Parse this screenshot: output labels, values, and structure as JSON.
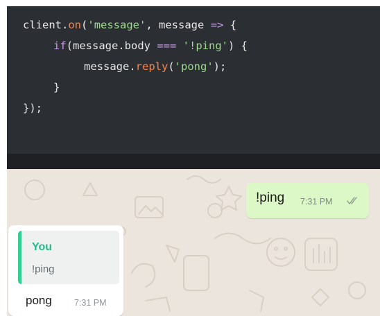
{
  "code": {
    "lines": [
      {
        "t1": "client",
        "t2": ".",
        "t3": "on",
        "t4": "(",
        "t5": "'message'",
        "t6": ", message ",
        "t7": "=>",
        "t8": " {"
      },
      {
        "t1": "if",
        "t2": "(message.body ",
        "t3": "===",
        "t4": " ",
        "t5": "'!ping'",
        "t6": ") {"
      },
      {
        "t1": "message.",
        "t2": "reply",
        "t3": "(",
        "t4": "'pong'",
        "t5": ");"
      },
      {
        "t1": "}"
      },
      {
        "t1": "});"
      }
    ]
  },
  "chat": {
    "outgoing": {
      "text": "!ping",
      "time": "7:31 PM",
      "status_icon": "double-check-icon"
    },
    "incoming": {
      "quote_author": "You",
      "quote_text": "!ping",
      "text": "pong",
      "time": "7:31 PM"
    }
  },
  "colors": {
    "code_bg": "#2b2e33",
    "chat_bg": "#ece5dd",
    "outgoing_bubble": "#dcf8c6",
    "incoming_bubble": "#ffffff",
    "quote_accent": "#35cd96"
  }
}
